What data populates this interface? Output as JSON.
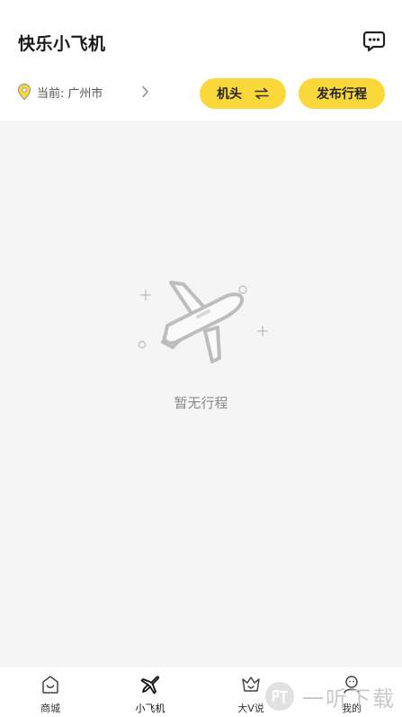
{
  "header": {
    "title": "快乐小飞机",
    "location_prefix": "当前:",
    "location_city": "广州市",
    "switch_label": "机头",
    "publish_label": "发布行程"
  },
  "empty_state": {
    "text": "暂无行程"
  },
  "tabbar": {
    "items": [
      {
        "label": "商城",
        "icon": "mall-bag-icon"
      },
      {
        "label": "小飞机",
        "icon": "plane-icon",
        "active": true
      },
      {
        "label": "大V说",
        "icon": "crown-icon"
      },
      {
        "label": "我的",
        "icon": "profile-icon"
      }
    ]
  },
  "watermark": {
    "text": "一听下载"
  },
  "colors": {
    "accent": "#fbd83a",
    "background": "#f5f5f5",
    "muted_text": "#8a8a8a"
  }
}
